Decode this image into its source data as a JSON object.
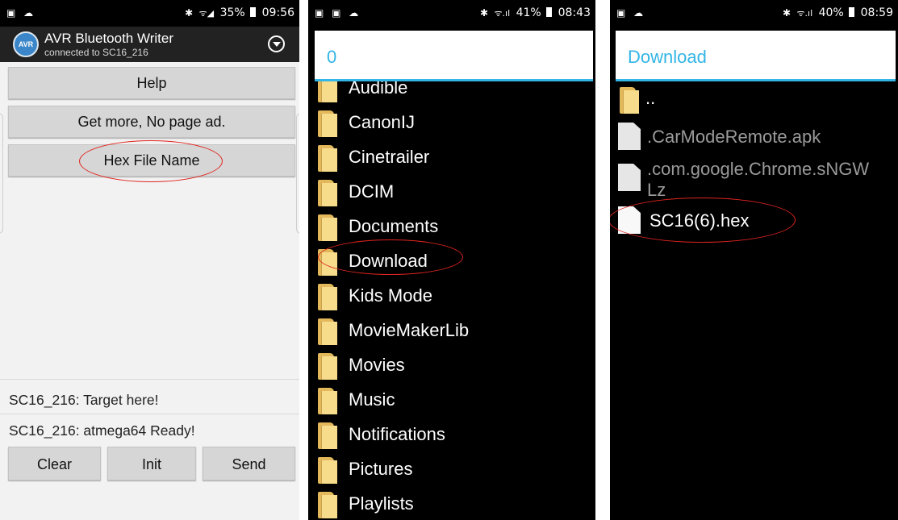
{
  "panel1": {
    "status": {
      "left": "▣ ☁",
      "bluetooth": "✱",
      "signal": "ᯤ◢",
      "battery": "35%",
      "time": "09:56"
    },
    "app": {
      "logo_text": "AVR",
      "title": "AVR Bluetooth Writer",
      "subtitle": "connected to SC16_216"
    },
    "buttons": {
      "help": "Help",
      "more": "Get more, No page ad.",
      "hex": "Hex File Name",
      "clear": "Clear",
      "init": "Init",
      "send": "Send"
    },
    "log": [
      "SC16_216:  Target here!",
      "SC16_216:  atmega64 Ready!"
    ],
    "highlight_color": "#e0251f"
  },
  "panel2": {
    "status": {
      "left": "▣ ▣ ☁",
      "bluetooth": "✱",
      "signal": "ᯤ.ıl",
      "battery": "41%",
      "time": "08:43"
    },
    "dialog_title": "0",
    "folders": [
      "Audible",
      "CanonIJ",
      "Cinetrailer",
      "DCIM",
      "Documents",
      "Download",
      "Kids Mode",
      "MovieMakerLib",
      "Movies",
      "Music",
      "Notifications",
      "Pictures",
      "Playlists"
    ],
    "selected": "Download",
    "accent_color": "#33b5e5"
  },
  "panel3": {
    "status": {
      "left": "▣ ☁",
      "bluetooth": "✱",
      "signal": "ᯤ.ıl",
      "battery": "40%",
      "time": "08:59"
    },
    "dialog_title": "Download",
    "items": [
      {
        "type": "folder",
        "label": ".."
      },
      {
        "type": "file",
        "label": ".CarModeRemote.apk"
      },
      {
        "type": "file",
        "label": ".com.google.Chrome.sNGW",
        "label_cont": "Lz"
      },
      {
        "type": "file",
        "label": "SC16(6).hex"
      }
    ],
    "selected": "SC16(6).hex"
  }
}
